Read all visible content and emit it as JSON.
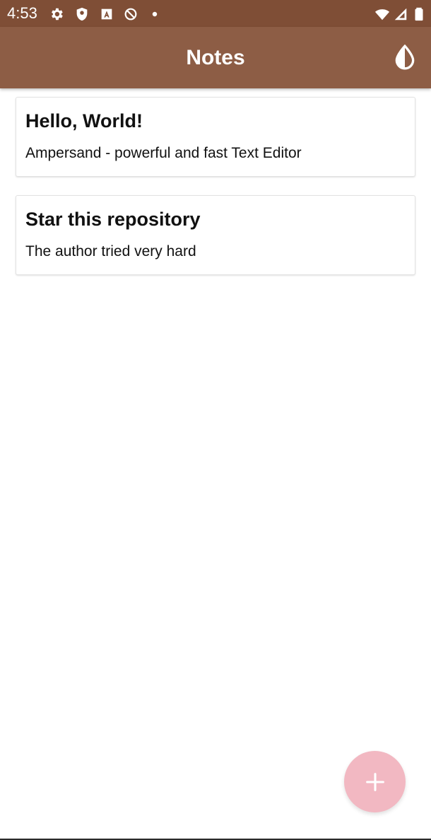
{
  "status_bar": {
    "time": "4:53",
    "icons": [
      "settings-icon",
      "shield-icon",
      "font-a-icon",
      "no-sync-icon",
      "dot-icon",
      "wifi-icon",
      "signal-icon",
      "battery-icon"
    ]
  },
  "app_bar": {
    "title": "Notes",
    "action_icon": "theme-drop-icon"
  },
  "notes": [
    {
      "title": "Hello, World!",
      "body": "Ampersand - powerful and fast Text Editor"
    },
    {
      "title": "Star this repository",
      "body": "The author tried very hard"
    }
  ],
  "fab": {
    "icon": "plus-icon"
  },
  "colors": {
    "status_bar": "#7f4e36",
    "app_bar": "#8d5d45",
    "fab": "#f2b8c2",
    "text": "#111111"
  }
}
